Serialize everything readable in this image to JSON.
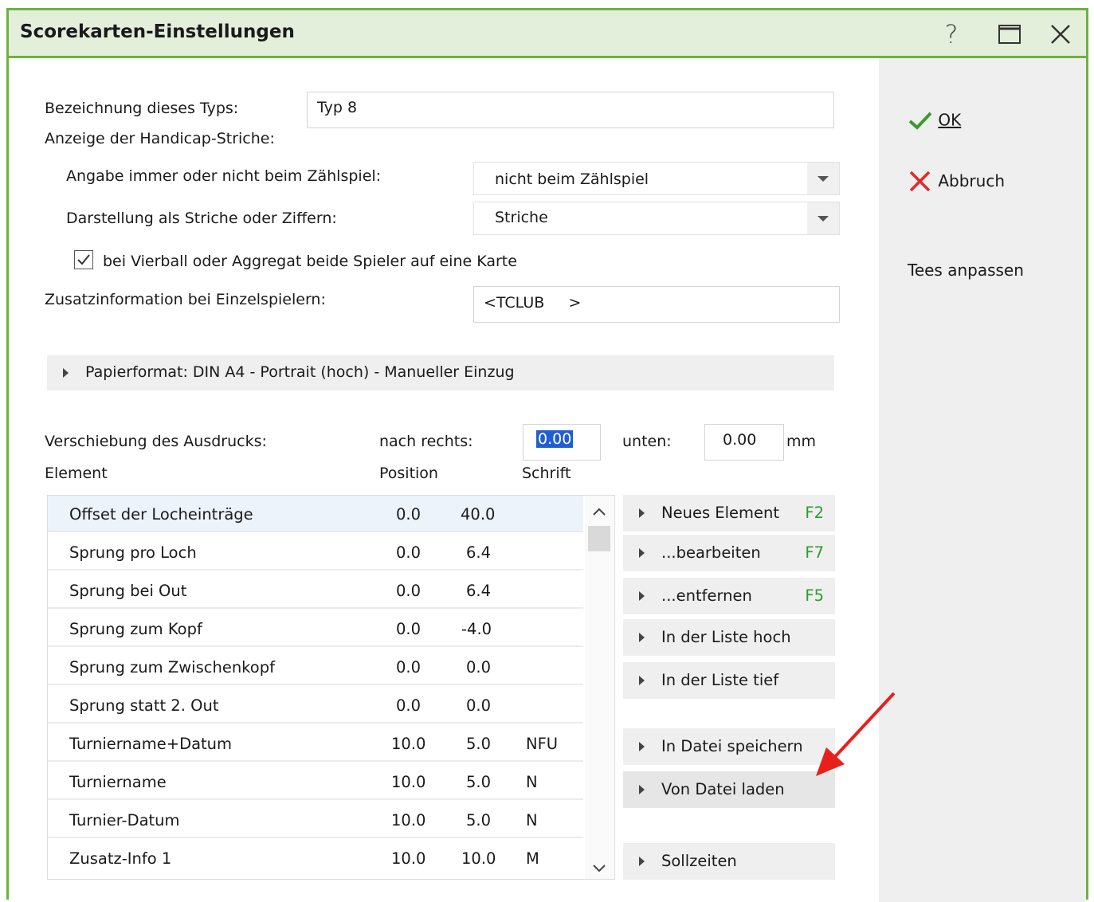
{
  "window": {
    "title": "Scorekarten-Einstellungen"
  },
  "form": {
    "name_label": "Bezeichnung dieses Typs:",
    "name_value": "Typ 8",
    "handicap_label": "Anzeige der Handicap-Striche:",
    "angabe_label": "Angabe immer oder nicht beim Zählspiel:",
    "angabe_value": "nicht beim Zählspiel",
    "darstellung_label": "Darstellung als Striche oder Ziffern:",
    "darstellung_value": "Striche",
    "vierball_label": "bei Vierball oder Aggregat beide Spieler auf eine Karte",
    "vierball_checked": true,
    "zusatz_label": "Zusatzinformation bei Einzelspielern:",
    "zusatz_value": "<TCLUB     >",
    "paper_label": "Papierformat: DIN A4 - Portrait (hoch) - Manueller Einzug",
    "shift_label": "Verschiebung des Ausdrucks:",
    "right_label": "nach rechts:",
    "right_value": "0.00",
    "down_label": "unten:",
    "down_value": "0.00",
    "unit": "mm"
  },
  "table": {
    "headers": [
      "Element",
      "Position",
      "Schrift"
    ],
    "rows": [
      [
        "Offset der Locheinträge",
        "0.0",
        "40.0",
        ""
      ],
      [
        "Sprung pro Loch",
        "0.0",
        "6.4",
        ""
      ],
      [
        "Sprung bei Out",
        "0.0",
        "6.4",
        ""
      ],
      [
        "Sprung zum Kopf",
        "0.0",
        "-4.0",
        ""
      ],
      [
        "Sprung zum Zwischenkopf",
        "0.0",
        "0.0",
        ""
      ],
      [
        "Sprung statt 2. Out",
        "0.0",
        "0.0",
        ""
      ],
      [
        "Turniername+Datum",
        "10.0",
        "5.0",
        "NFU"
      ],
      [
        "Turniername",
        "10.0",
        "5.0",
        "N"
      ],
      [
        "Turnier-Datum",
        "10.0",
        "5.0",
        "N"
      ],
      [
        "Zusatz-Info 1",
        "10.0",
        "10.0",
        "M"
      ]
    ]
  },
  "actions": [
    {
      "label": "Neues Element",
      "key": "F2"
    },
    {
      "label": "...bearbeiten",
      "key": "F7"
    },
    {
      "label": "...entfernen",
      "key": "F5"
    },
    {
      "label": "In der Liste hoch",
      "key": ""
    },
    {
      "label": "In der Liste tief",
      "key": ""
    },
    {
      "label": "In Datei speichern",
      "key": ""
    },
    {
      "label": "Von Datei laden",
      "key": ""
    },
    {
      "label": "Sollzeiten",
      "key": ""
    }
  ],
  "side": {
    "ok": "OK",
    "cancel": "Abbruch",
    "tees": "Tees anpassen"
  },
  "colors": {
    "accent": "#6cb33e",
    "key": "#2e9b2e",
    "annotation_arrow": "#e8201c"
  }
}
